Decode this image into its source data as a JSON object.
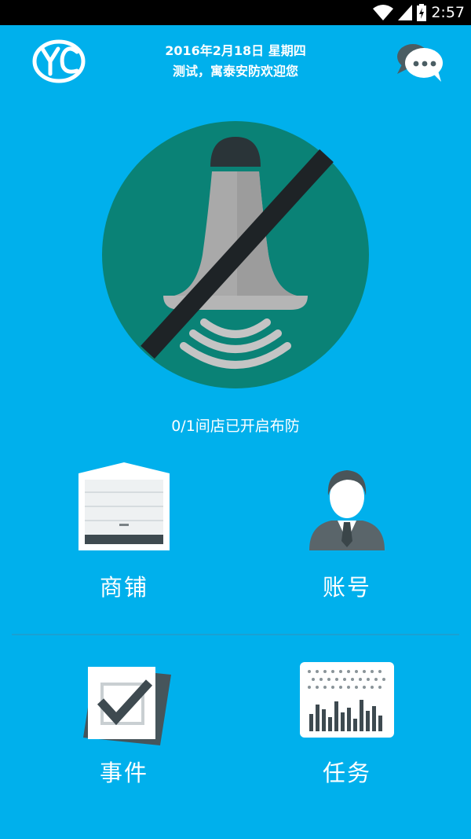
{
  "status_bar": {
    "time": "2:57",
    "icons": [
      "wifi-icon",
      "cell-signal-icon",
      "battery-charging-icon"
    ]
  },
  "header": {
    "date": "2016年2月18日 星期四",
    "welcome": "测试，寓泰安防欢迎您",
    "logo_text": "YC",
    "message_icon": "chat-bubbles-icon"
  },
  "alarm": {
    "icon": "alarm-disarmed-icon",
    "status_text": "0/1间店已开启布防",
    "colors": {
      "circle": "#0a8276",
      "bell": "#a9a9a9",
      "slash": "#1e2326"
    }
  },
  "menu": {
    "shops": {
      "label": "商铺",
      "icon": "storefront-shutter-icon"
    },
    "account": {
      "label": "账号",
      "icon": "user-avatar-icon"
    },
    "events": {
      "label": "事件",
      "icon": "checkbox-icon"
    },
    "tasks": {
      "label": "任务",
      "icon": "bar-chart-icon"
    }
  },
  "colors": {
    "background": "#00b0ec",
    "status_bar": "#000000",
    "text": "#ffffff"
  }
}
